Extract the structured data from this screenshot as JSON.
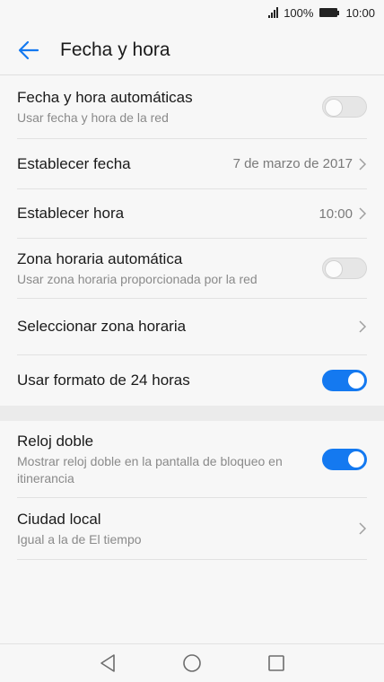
{
  "status_bar": {
    "battery": "100%",
    "time": "10:00"
  },
  "header": {
    "title": "Fecha y hora"
  },
  "settings": [
    {
      "title": "Fecha y hora automáticas",
      "subtitle": "Usar fecha y hora de la red",
      "toggle": "off"
    },
    {
      "title": "Establecer fecha",
      "value": "7 de marzo de 2017"
    },
    {
      "title": "Establecer hora",
      "value": "10:00"
    },
    {
      "title": "Zona horaria automática",
      "subtitle": "Usar zona horaria proporcionada por la red",
      "toggle": "off"
    },
    {
      "title": "Seleccionar zona horaria"
    },
    {
      "title": "Usar formato de 24 horas",
      "toggle": "on"
    }
  ],
  "settings2": [
    {
      "title": "Reloj doble",
      "subtitle": "Mostrar reloj doble en la pantalla de bloqueo en itinerancia",
      "toggle": "on"
    },
    {
      "title": "Ciudad local",
      "subtitle": "Igual a la de El tiempo"
    }
  ],
  "colors": {
    "accent": "#1479f0",
    "background": "#f7f7f7"
  },
  "icons": {
    "back": "arrow-left-icon",
    "nav_back": "triangle-back-icon",
    "nav_home": "circle-home-icon",
    "nav_recents": "square-recents-icon"
  }
}
